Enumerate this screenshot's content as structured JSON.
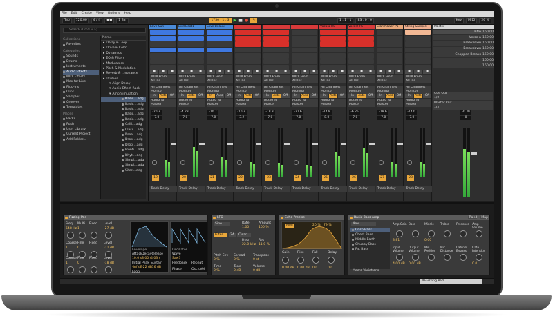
{
  "menu": [
    "File",
    "Edit",
    "Create",
    "View",
    "Options",
    "Help"
  ],
  "toolbar": {
    "tap": "Tap",
    "tempo": "120.00",
    "signature": "4 / 4",
    "metronome": "●●",
    "quantize": "1 Bar",
    "position": "1750 . 1 . 3",
    "loop_start": "1 . 1 . 1",
    "loop_len": "83 . 0 . 0",
    "key": "Key",
    "midi": "MIDI",
    "cpu": "26 %"
  },
  "browser": {
    "search_placeholder": "Search (Cmd + F)",
    "collections_header": "Collections",
    "collections": [
      "Favorites"
    ],
    "categories_header": "Categories",
    "categories": [
      "Sounds",
      "Drums",
      "Instruments",
      "Audio Effects",
      "MIDI Effects",
      "Max for Live",
      "Plug-Ins",
      "Clips",
      "Samples",
      "Grooves",
      "Templates"
    ],
    "places_header": "Places",
    "places": [
      "Packs",
      "Push",
      "User Library",
      "Current Project",
      "Add Folder..."
    ],
    "name_header": "Name",
    "folders": [
      "Delay & Loop",
      "Drive & Color",
      "Dynamics",
      "EQ & Filters",
      "Modulators",
      "Pitch & Modulation",
      "Reverb & ...sonance",
      "Utilities"
    ],
    "sub_folders": [
      "Align Delay",
      "Audio Effect Rack",
      "Amp Simulation"
    ],
    "files": [
      "Basic....adg",
      "Basic....adg",
      "Basic....adg",
      "Basic....adg",
      "Basic....adg",
      "Calli....adg",
      "Class....adg",
      "Drea....adg",
      "Drop....adg",
      "Drop....adg",
      "Fronti....adg",
      "Rhyt....adg",
      "Simpl....adg",
      "Simpl....adg",
      "Sitar....adg"
    ]
  },
  "tracks": [
    {
      "name": "Love Sun",
      "color": "#4a8ad8",
      "clips": [
        "#3f78e0",
        "#3f78e0",
        "#3a3a3a",
        "#3f78e0",
        "#3a3a3a",
        "#3a3a3a",
        "#3a3a3a"
      ],
      "vol": "-20.3",
      "pan": "-7.0",
      "num": "19",
      "meter": 0.35,
      "monitor_on": "Auto"
    },
    {
      "name": "Bird Beat1",
      "color": "#4a8ad8",
      "clips": [
        "#3f78e0",
        "#3f78e0",
        "#3a3a3a",
        "#3f78e0",
        "#3a3a3a",
        "#3a3a3a",
        "#3a3a3a"
      ],
      "vol": "-4.73",
      "pan": "-7.0",
      "num": "20",
      "meter": 0.62,
      "monitor_on": "Auto"
    },
    {
      "name": "Love Beauu",
      "color": "#4a8ad8",
      "clips": [
        "#3f78e0",
        "#3f78e0",
        "#3a3a3a",
        "#3f78e0",
        "#3a3a3a",
        "#3a3a3a",
        "#3a3a3a"
      ],
      "vol": "-10.7",
      "pan": "-7.0",
      "num": "21",
      "meter": 0.4,
      "monitor_on": "In"
    },
    {
      "name": "",
      "color": "#d83a3a",
      "clips": [
        "#d8302a",
        "#d8302a",
        "#d8302a",
        "#3a3a3a",
        "#3a3a3a",
        "#3a3a3a",
        "#3a3a3a"
      ],
      "vol": "-10.3",
      "pan": "-3.2",
      "num": "22",
      "meter": 0.3,
      "monitor_on": "Auto"
    },
    {
      "name": "",
      "color": "#d83a3a",
      "clips": [
        "#d8302a",
        "#d8302a",
        "#d8302a",
        "#3a3a3a",
        "#3a3a3a",
        "#3a3a3a",
        "#3a3a3a"
      ],
      "vol": "-18.3",
      "pan": "-7.0",
      "num": "23",
      "meter": 0.28,
      "monitor_on": "Auto"
    },
    {
      "name": "",
      "color": "#d83a3a",
      "clips": [
        "#3a3a3a",
        "#3a3a3a",
        "#3a3a3a",
        "#3a3a3a",
        "#3a3a3a",
        "#3a3a3a",
        "#3a3a3a"
      ],
      "vol": "-21.6",
      "pan": "-7.0",
      "num": "24",
      "meter": 0.25,
      "monitor_on": "Auto"
    },
    {
      "name": "Vocal1 Pa",
      "color": "#d83a3a",
      "clips": [
        "#d8302a",
        "#d8302a",
        "#d8302a",
        "#3a3a3a",
        "#3a3a3a",
        "#3a3a3a",
        "#3a3a3a"
      ],
      "vol": "-14.9",
      "pan": "-8.0",
      "num": "25",
      "meter": 0.5,
      "monitor_on": "Auto"
    },
    {
      "name": "Vocal2 Pa",
      "color": "#d83a3a",
      "clips": [
        "#d8302a",
        "#d8302a",
        "#d8302a",
        "#3a3a3a",
        "#3a3a3a",
        "#3a3a3a",
        "#3a3a3a"
      ],
      "vol": "-6.25",
      "pan": "-7.0",
      "num": "26",
      "meter": 0.58,
      "monitor_on": "Auto"
    },
    {
      "name": "Starshower Pa",
      "color": "#e8a67a",
      "clips": [
        "#3a3a3a",
        "#3a3a3a",
        "#3a3a3a",
        "#3a3a3a",
        "#3a3a3a",
        "#3a3a3a",
        "#3a3a3a"
      ],
      "vol": "-18.6",
      "pan": "-7.0",
      "num": "27",
      "meter": 0.3,
      "monitor_on": "Auto"
    },
    {
      "name": "String Sample",
      "color": "#f0b090",
      "clips": [
        "#f2b894",
        "#3a3a3a",
        "#3a3a3a",
        "#3a3a3a",
        "#3a3a3a",
        "#3a3a3a",
        "#3a3a3a"
      ],
      "vol": "-14.0",
      "pan": "-7.0",
      "num": "28",
      "meter": 0.3,
      "monitor_on": "Auto"
    }
  ],
  "track_labels": {
    "midi_from": "MIDI From",
    "all_ins": "All Ins",
    "all_channels": "All Channels",
    "monitor": "Monitor",
    "in": "In",
    "auto": "Auto",
    "off": "Off",
    "audio_to": "Audio To",
    "master": "Master",
    "track_delay": "Track Delay"
  },
  "master": {
    "name": "Master",
    "scenes": [
      {
        "name": "Intro",
        "bpm": "160.00"
      },
      {
        "name": "Verse A",
        "bpm": "160.00"
      },
      {
        "name": "Breakdown",
        "bpm": "160.00"
      },
      {
        "name": "Breakdown",
        "bpm": "160.00"
      },
      {
        "name": "Chopped Breaks",
        "bpm": "160.00"
      },
      {
        "name": "",
        "bpm": "160.00"
      },
      {
        "name": "",
        "bpm": "160.00"
      }
    ],
    "cue_out": "Cue Out",
    "cue_val": "1/2",
    "master_out": "Master Out",
    "master_val": "1/2",
    "vol": "-0.30",
    "pan": "0"
  },
  "devices": {
    "operator": {
      "title": "Fizzing Pad",
      "labels": [
        "Freq",
        "Multi",
        "Fixed",
        "Level",
        "Coarse",
        "Fine",
        "Fixed",
        "Level",
        "Coarse",
        "Fine",
        "Fixed",
        "Level"
      ],
      "values": [
        "548 Hz",
        "1",
        "",
        "-27 dB",
        "1",
        "0",
        "",
        "-11 dB",
        "1",
        "0",
        "",
        "-18 dB"
      ],
      "env": {
        "title": "Envelope",
        "attack": "Attack",
        "decay": "Decay",
        "release": "Release",
        "time_vel": "Time<Vel",
        "a_val": "10.0 s",
        "d_val": "8.00 s",
        "r_val": "4.03 s",
        "tv_val": "0 %",
        "initial": "Initial",
        "peak": "Peak",
        "sustain": "Sustain",
        "vel": "Vel",
        "i_val": "-inf dB",
        "p_val": "-22 dB",
        "s_val": "-16 dB",
        "v_val": "0 %",
        "loop": "Loop",
        "loop_val": "None"
      },
      "osc": {
        "title": "Oscillator",
        "wave": "Wave",
        "wave_val": "Saw3",
        "feedback": "Feedback",
        "repeat": "Repeat",
        "phase": "Phase",
        "osc_vel": "Osc<Vel",
        "key": "Key",
        "key_val": "21 %"
      }
    },
    "lfo": {
      "title": "LFO",
      "sine": "Sine",
      "rate": "Rate",
      "amount": "Amount",
      "filter": "Filter",
      "filter_val": "24",
      "clean": "Clean",
      "freq": "Freq",
      "res": "Res",
      "pitch_env": "Pitch Env",
      "spread": "Spread",
      "transpose": "Transpose",
      "time": "Time",
      "tone": "Tone",
      "volume": "Volume",
      "vals": [
        "1.00",
        "100 %",
        "22.0 kHz",
        "11.0 %",
        "0 %",
        "0 %",
        "0 st",
        "0 %",
        "0 dB",
        "0 dB"
      ]
    },
    "ring": {
      "title": "Echo Precise",
      "vals": [
        "Mod",
        "20 %",
        "79 %",
        "0.00 dB",
        "0.00 dB",
        "0.0",
        "0.0"
      ],
      "labels": [
        "Gain",
        "Rise",
        "Fall",
        "Delay"
      ]
    },
    "bass": {
      "title": "Basic Bass Amp",
      "new": "New",
      "presets": [
        "Crisp Bass",
        "Chest Bass",
        "Middle Earth",
        "Chubby Bass",
        "Fat Bass"
      ],
      "macro": "Macro Variations",
      "knobs": [
        "Amp Gain",
        "Bass",
        "Middle",
        "Treble",
        "Presence",
        "Amp Volume",
        "Input Volume",
        "Output Volume",
        "Mid Position",
        "Mic Distance",
        "Cabinet Bypass",
        "Gate Intensity"
      ],
      "vals": [
        "3.81",
        "",
        "0.00",
        "",
        "",
        "",
        "4.00 dB",
        "0.00 dB",
        "",
        "",
        "",
        "0.0"
      ],
      "buttons": [
        "Rand",
        "Map"
      ]
    }
  },
  "footer": {
    "clip_name": "30-Fizzing Pad"
  },
  "colors": {
    "accent": "#e8a63a",
    "blue": "#3f78e0",
    "red": "#d8302a",
    "peach": "#f2b894",
    "meter": "#5ad04a"
  }
}
